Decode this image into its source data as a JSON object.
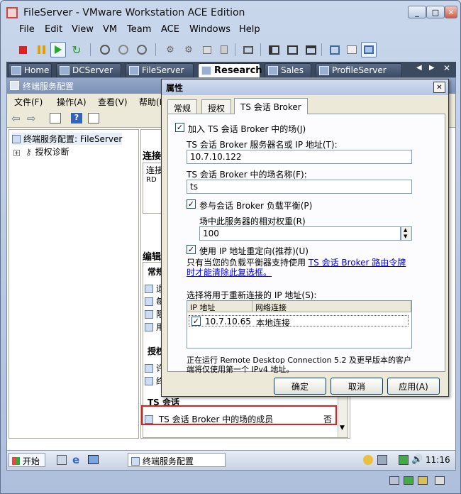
{
  "window": {
    "title": "FileServer - VMware Workstation ACE Edition",
    "min": "_",
    "max": "□",
    "close": "✕"
  },
  "menubar": [
    "File",
    "Edit",
    "View",
    "VM",
    "Team",
    "ACE",
    "Windows",
    "Help"
  ],
  "vm_tabs": [
    "Home",
    "DCServer",
    "FileServer",
    "Research",
    "Sales",
    "ProfileServer"
  ],
  "vm_tab_active": 3,
  "mmc": {
    "title": "终端服务配置",
    "menu": [
      "文件(F)",
      "操作(A)",
      "查看(V)",
      "帮助(H)"
    ],
    "tree_root": "终端服务配置: FileServer",
    "tree_child": "授权诊断",
    "results": {
      "section1_fragment": "连接",
      "col_fragment": "连接",
      "row_fragment": "RD",
      "section2_fragment": "编辑",
      "group1_fragment": "常规",
      "items1": [
        "退",
        "每",
        "限",
        "用"
      ],
      "group2_fragment": "授权",
      "items2": [
        "许",
        "终"
      ],
      "group3_fragment": "TS 会话",
      "broker_row_label": "TS 会话 Broker 中的场的成员",
      "broker_row_value": "否"
    }
  },
  "taskbar": {
    "start": "开始",
    "task": "终端服务配置",
    "clock": "11:16"
  },
  "dialog": {
    "title": "属性",
    "close": "✕",
    "tabs": [
      "常规",
      "授权",
      "TS 会话 Broker"
    ],
    "join_farm_label": "加入 TS 会话 Broker 中的场(J)",
    "join_farm_checked": "✓",
    "server_label": "TS 会话 Broker 服务器名或 IP 地址(T):",
    "server_value": "10.7.10.122",
    "farm_name_label": "TS 会话 Broker 中的场名称(F):",
    "farm_name_value": "ts",
    "load_balance_label": "参与会话 Broker 负载平衡(P)",
    "load_balance_checked": "✓",
    "weight_label": "场中此服务器的相对权重(R)",
    "weight_value": "100",
    "ip_redirect_label": "使用 IP 地址重定向(推荐)(U)",
    "ip_redirect_checked": "✓",
    "note_prefix": "只有当您的负载平衡器支持使用 ",
    "note_link": "TS 会话 Broker 路由令牌时才能清除此复选框。",
    "ip_select_label": "选择将用于重新连接的 IP 地址(S):",
    "list_headers": [
      "IP 地址",
      "网络连接"
    ],
    "list_rows": [
      {
        "ip": "10.7.10.65",
        "conn": "本地连接",
        "checked": "✓"
      }
    ],
    "footnote_line1": "正在运行 Remote Desktop Connection 5.2 及更早版本的客户",
    "footnote_line2": "端将仅使用第一个 IPv4 地址。",
    "ok": "确定",
    "cancel": "取消",
    "apply": "应用(A)"
  }
}
